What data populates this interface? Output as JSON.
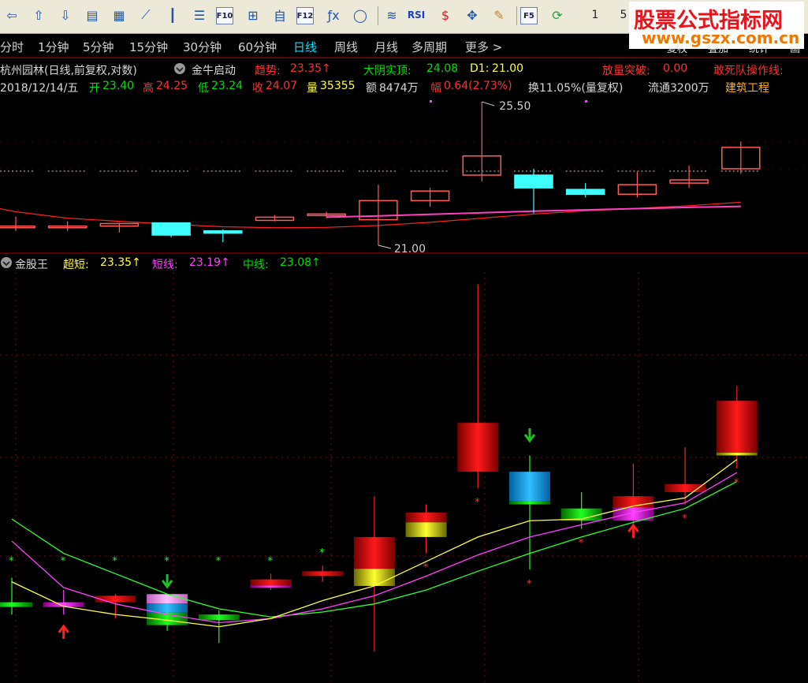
{
  "toolbar": {
    "icons": [
      "back-arrow-icon",
      "up-arrow-icon",
      "down-arrow-icon",
      "report-icon",
      "grid-icon",
      "line-chart-icon",
      "candle-icon",
      "list-icon",
      "f10-icon",
      "tree-icon",
      "self-icon",
      "f12-icon",
      "formula-icon",
      "circle-icon",
      "wave-icon",
      "rsi-icon",
      "money-icon",
      "move-icon",
      "pen-icon",
      "f5-icon",
      "refresh-icon"
    ],
    "labels": {
      "f10": "F10",
      "f12": "F12",
      "rsi": "RSI",
      "f5": "F5",
      "num1": "1",
      "num5": "5"
    }
  },
  "brand": {
    "title": "股票公式指标网",
    "url": "www.gszx.com.cn"
  },
  "right_tabs": [
    "复权",
    "叠加",
    "统计",
    "画"
  ],
  "timeframes": {
    "items": [
      "分时",
      "1分钟",
      "5分钟",
      "15分钟",
      "30分钟",
      "60分钟",
      "日线",
      "周线",
      "月线",
      "多周期",
      "更多 >"
    ],
    "active": "日线"
  },
  "info_line1": {
    "stock": "杭州园林(日线,前复权,对数)",
    "indicator": "金牛启动",
    "trend_label": "趋势:",
    "trend_value": "23.35↑",
    "yin_label": "大阴实顶:",
    "yin_value": "24.08",
    "d1_label": "D1:",
    "d1_value": "21.00",
    "volume_break_label": "放量突破:",
    "volume_break_value": "0.00",
    "dead_team_label": "敢死队操作线:"
  },
  "info_line2": {
    "date": "2018/12/14/五",
    "open_label": "开",
    "open": "23.40",
    "high_label": "高",
    "high": "24.25",
    "low_label": "低",
    "low": "23.24",
    "close_label": "收",
    "close": "24.07",
    "vol_label": "量",
    "vol": "35355",
    "amt_label": "额",
    "amt": "8474万",
    "chg_label": "幅",
    "chg": "0.64(2.73%)",
    "turnover": "换11.05%(量复权)",
    "float": "流通3200万",
    "sector": "建筑工程"
  },
  "main_chart": {
    "high_marker": "25.50",
    "low_marker": "21.00"
  },
  "sub_chart": {
    "name": "金股王",
    "s1_label": "超短:",
    "s1_value": "23.35↑",
    "s2_label": "短线:",
    "s2_value": "23.19↑",
    "s3_label": "中线:",
    "s3_value": "23.08↑"
  },
  "chart_data": {
    "type": "candlestick",
    "bars": [
      {
        "o": 21.6,
        "h": 21.9,
        "l": 21.45,
        "c": 21.6
      },
      {
        "o": 21.55,
        "h": 21.75,
        "l": 21.45,
        "c": 21.6
      },
      {
        "o": 21.6,
        "h": 21.7,
        "l": 21.4,
        "c": 21.68
      },
      {
        "o": 21.7,
        "h": 21.7,
        "l": 21.25,
        "c": 21.32
      },
      {
        "o": 21.45,
        "h": 21.5,
        "l": 21.1,
        "c": 21.38
      },
      {
        "o": 21.78,
        "h": 21.95,
        "l": 21.75,
        "c": 21.88
      },
      {
        "o": 21.93,
        "h": 22.05,
        "l": 21.85,
        "c": 21.98
      },
      {
        "o": 21.8,
        "h": 22.9,
        "l": 21.0,
        "c": 22.4
      },
      {
        "o": 22.4,
        "h": 22.8,
        "l": 22.2,
        "c": 22.7
      },
      {
        "o": 23.2,
        "h": 25.5,
        "l": 23.0,
        "c": 23.8
      },
      {
        "o": 23.2,
        "h": 23.4,
        "l": 22.0,
        "c": 22.8
      },
      {
        "o": 22.75,
        "h": 22.95,
        "l": 22.5,
        "c": 22.6
      },
      {
        "o": 22.6,
        "h": 23.3,
        "l": 22.5,
        "c": 22.9
      },
      {
        "o": 22.95,
        "h": 23.5,
        "l": 22.8,
        "c": 23.05
      },
      {
        "o": 23.4,
        "h": 24.25,
        "l": 23.24,
        "c": 24.07
      }
    ],
    "up_color": "#ff5a5a",
    "down_color": "#40ffff"
  }
}
